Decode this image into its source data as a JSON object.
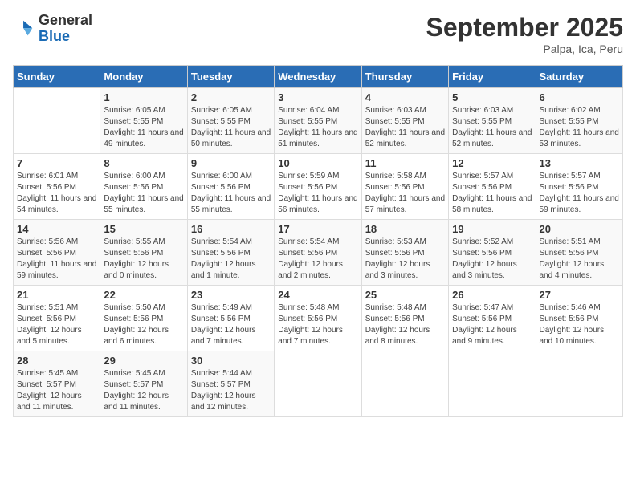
{
  "header": {
    "logo_general": "General",
    "logo_blue": "Blue",
    "month_title": "September 2025",
    "location": "Palpa, Ica, Peru"
  },
  "days_of_week": [
    "Sunday",
    "Monday",
    "Tuesday",
    "Wednesday",
    "Thursday",
    "Friday",
    "Saturday"
  ],
  "weeks": [
    [
      {
        "day": "",
        "sunrise": "",
        "sunset": "",
        "daylight": ""
      },
      {
        "day": "1",
        "sunrise": "6:05 AM",
        "sunset": "5:55 PM",
        "daylight": "11 hours and 49 minutes."
      },
      {
        "day": "2",
        "sunrise": "6:05 AM",
        "sunset": "5:55 PM",
        "daylight": "11 hours and 50 minutes."
      },
      {
        "day": "3",
        "sunrise": "6:04 AM",
        "sunset": "5:55 PM",
        "daylight": "11 hours and 51 minutes."
      },
      {
        "day": "4",
        "sunrise": "6:03 AM",
        "sunset": "5:55 PM",
        "daylight": "11 hours and 52 minutes."
      },
      {
        "day": "5",
        "sunrise": "6:03 AM",
        "sunset": "5:55 PM",
        "daylight": "11 hours and 52 minutes."
      },
      {
        "day": "6",
        "sunrise": "6:02 AM",
        "sunset": "5:55 PM",
        "daylight": "11 hours and 53 minutes."
      }
    ],
    [
      {
        "day": "7",
        "sunrise": "6:01 AM",
        "sunset": "5:56 PM",
        "daylight": "11 hours and 54 minutes."
      },
      {
        "day": "8",
        "sunrise": "6:00 AM",
        "sunset": "5:56 PM",
        "daylight": "11 hours and 55 minutes."
      },
      {
        "day": "9",
        "sunrise": "6:00 AM",
        "sunset": "5:56 PM",
        "daylight": "11 hours and 55 minutes."
      },
      {
        "day": "10",
        "sunrise": "5:59 AM",
        "sunset": "5:56 PM",
        "daylight": "11 hours and 56 minutes."
      },
      {
        "day": "11",
        "sunrise": "5:58 AM",
        "sunset": "5:56 PM",
        "daylight": "11 hours and 57 minutes."
      },
      {
        "day": "12",
        "sunrise": "5:57 AM",
        "sunset": "5:56 PM",
        "daylight": "11 hours and 58 minutes."
      },
      {
        "day": "13",
        "sunrise": "5:57 AM",
        "sunset": "5:56 PM",
        "daylight": "11 hours and 59 minutes."
      }
    ],
    [
      {
        "day": "14",
        "sunrise": "5:56 AM",
        "sunset": "5:56 PM",
        "daylight": "11 hours and 59 minutes."
      },
      {
        "day": "15",
        "sunrise": "5:55 AM",
        "sunset": "5:56 PM",
        "daylight": "12 hours and 0 minutes."
      },
      {
        "day": "16",
        "sunrise": "5:54 AM",
        "sunset": "5:56 PM",
        "daylight": "12 hours and 1 minute."
      },
      {
        "day": "17",
        "sunrise": "5:54 AM",
        "sunset": "5:56 PM",
        "daylight": "12 hours and 2 minutes."
      },
      {
        "day": "18",
        "sunrise": "5:53 AM",
        "sunset": "5:56 PM",
        "daylight": "12 hours and 3 minutes."
      },
      {
        "day": "19",
        "sunrise": "5:52 AM",
        "sunset": "5:56 PM",
        "daylight": "12 hours and 3 minutes."
      },
      {
        "day": "20",
        "sunrise": "5:51 AM",
        "sunset": "5:56 PM",
        "daylight": "12 hours and 4 minutes."
      }
    ],
    [
      {
        "day": "21",
        "sunrise": "5:51 AM",
        "sunset": "5:56 PM",
        "daylight": "12 hours and 5 minutes."
      },
      {
        "day": "22",
        "sunrise": "5:50 AM",
        "sunset": "5:56 PM",
        "daylight": "12 hours and 6 minutes."
      },
      {
        "day": "23",
        "sunrise": "5:49 AM",
        "sunset": "5:56 PM",
        "daylight": "12 hours and 7 minutes."
      },
      {
        "day": "24",
        "sunrise": "5:48 AM",
        "sunset": "5:56 PM",
        "daylight": "12 hours and 7 minutes."
      },
      {
        "day": "25",
        "sunrise": "5:48 AM",
        "sunset": "5:56 PM",
        "daylight": "12 hours and 8 minutes."
      },
      {
        "day": "26",
        "sunrise": "5:47 AM",
        "sunset": "5:56 PM",
        "daylight": "12 hours and 9 minutes."
      },
      {
        "day": "27",
        "sunrise": "5:46 AM",
        "sunset": "5:56 PM",
        "daylight": "12 hours and 10 minutes."
      }
    ],
    [
      {
        "day": "28",
        "sunrise": "5:45 AM",
        "sunset": "5:57 PM",
        "daylight": "12 hours and 11 minutes."
      },
      {
        "day": "29",
        "sunrise": "5:45 AM",
        "sunset": "5:57 PM",
        "daylight": "12 hours and 11 minutes."
      },
      {
        "day": "30",
        "sunrise": "5:44 AM",
        "sunset": "5:57 PM",
        "daylight": "12 hours and 12 minutes."
      },
      {
        "day": "",
        "sunrise": "",
        "sunset": "",
        "daylight": ""
      },
      {
        "day": "",
        "sunrise": "",
        "sunset": "",
        "daylight": ""
      },
      {
        "day": "",
        "sunrise": "",
        "sunset": "",
        "daylight": ""
      },
      {
        "day": "",
        "sunrise": "",
        "sunset": "",
        "daylight": ""
      }
    ]
  ]
}
